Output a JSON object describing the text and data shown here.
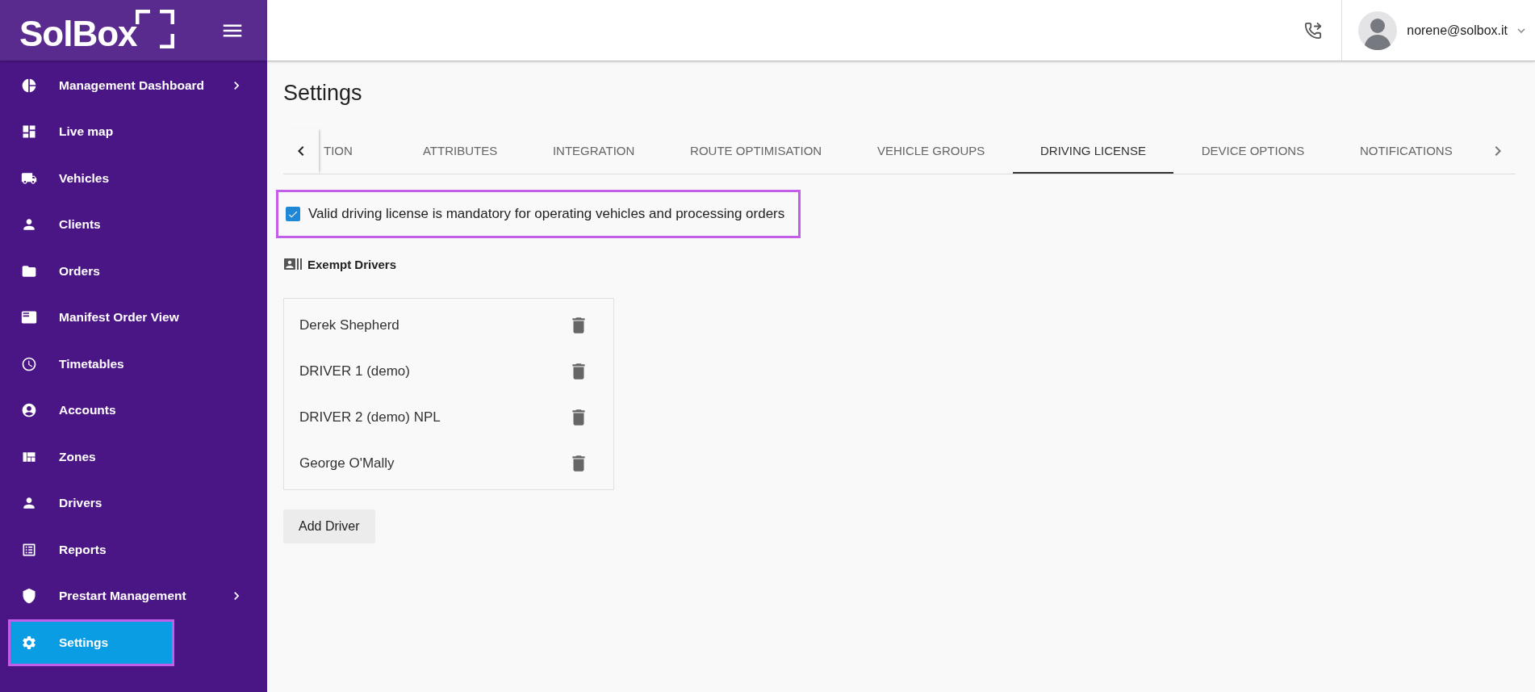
{
  "sidebar": {
    "logo": "SolBox",
    "items": [
      {
        "label": "Management Dashboard",
        "has_submenu": true,
        "selected": false,
        "highlighted": false
      },
      {
        "label": "Live map",
        "has_submenu": false,
        "selected": false,
        "highlighted": false
      },
      {
        "label": "Vehicles",
        "has_submenu": false,
        "selected": false,
        "highlighted": false
      },
      {
        "label": "Clients",
        "has_submenu": false,
        "selected": false,
        "highlighted": false
      },
      {
        "label": "Orders",
        "has_submenu": false,
        "selected": false,
        "highlighted": false
      },
      {
        "label": "Manifest Order View",
        "has_submenu": false,
        "selected": false,
        "highlighted": false
      },
      {
        "label": "Timetables",
        "has_submenu": false,
        "selected": false,
        "highlighted": false
      },
      {
        "label": "Accounts",
        "has_submenu": false,
        "selected": false,
        "highlighted": false
      },
      {
        "label": "Zones",
        "has_submenu": false,
        "selected": false,
        "highlighted": false
      },
      {
        "label": "Drivers",
        "has_submenu": false,
        "selected": false,
        "highlighted": false
      },
      {
        "label": "Reports",
        "has_submenu": false,
        "selected": false,
        "highlighted": false
      },
      {
        "label": "Prestart Management",
        "has_submenu": true,
        "selected": false,
        "highlighted": false
      },
      {
        "label": "Settings",
        "has_submenu": false,
        "selected": true,
        "highlighted": true
      }
    ]
  },
  "topbar": {
    "user": "norene@solbox.it"
  },
  "page": {
    "title": "Settings"
  },
  "tabs": [
    {
      "label": "TION",
      "selected": false
    },
    {
      "label": "ATTRIBUTES",
      "selected": false
    },
    {
      "label": "INTEGRATION",
      "selected": false
    },
    {
      "label": "ROUTE OPTIMISATION",
      "selected": false
    },
    {
      "label": "VEHICLE GROUPS",
      "selected": false
    },
    {
      "label": "DRIVING LICENSE",
      "selected": true
    },
    {
      "label": "DEVICE OPTIONS",
      "selected": false
    },
    {
      "label": "NOTIFICATIONS",
      "selected": false
    }
  ],
  "license_option": {
    "label": "Valid driving license is mandatory for operating vehicles and processing orders",
    "checked": true,
    "highlighted": true
  },
  "exempt": {
    "title": "Exempt Drivers",
    "drivers": [
      "Derek Shepherd",
      "DRIVER 1 (demo)",
      "DRIVER 2 (demo) NPL",
      "George O'Mally"
    ],
    "add_button": "Add Driver"
  }
}
